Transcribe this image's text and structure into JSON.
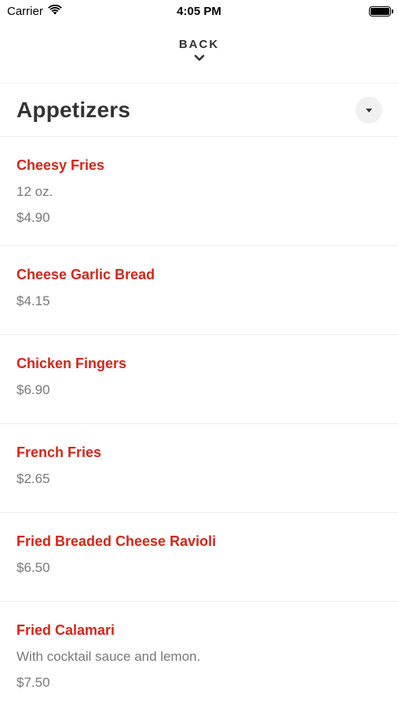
{
  "status": {
    "carrier": "Carrier",
    "time": "4:05 PM"
  },
  "nav": {
    "back_label": "BACK"
  },
  "section": {
    "title": "Appetizers"
  },
  "items": [
    {
      "name": "Cheesy Fries",
      "description": "12 oz.",
      "price": "$4.90"
    },
    {
      "name": "Cheese Garlic Bread",
      "description": "",
      "price": "$4.15"
    },
    {
      "name": "Chicken Fingers",
      "description": "",
      "price": "$6.90"
    },
    {
      "name": "French Fries",
      "description": "",
      "price": "$2.65"
    },
    {
      "name": "Fried Breaded Cheese Ravioli",
      "description": "",
      "price": "$6.50"
    },
    {
      "name": "Fried Calamari",
      "description": "With cocktail sauce and lemon.",
      "price": "$7.50"
    }
  ],
  "colors": {
    "accent": "#d0261c",
    "muted_text": "#777777"
  },
  "icons": {
    "wifi": "wifi-icon",
    "battery": "battery-icon",
    "back": "chevron-down-icon",
    "toggle": "caret-down-icon"
  }
}
